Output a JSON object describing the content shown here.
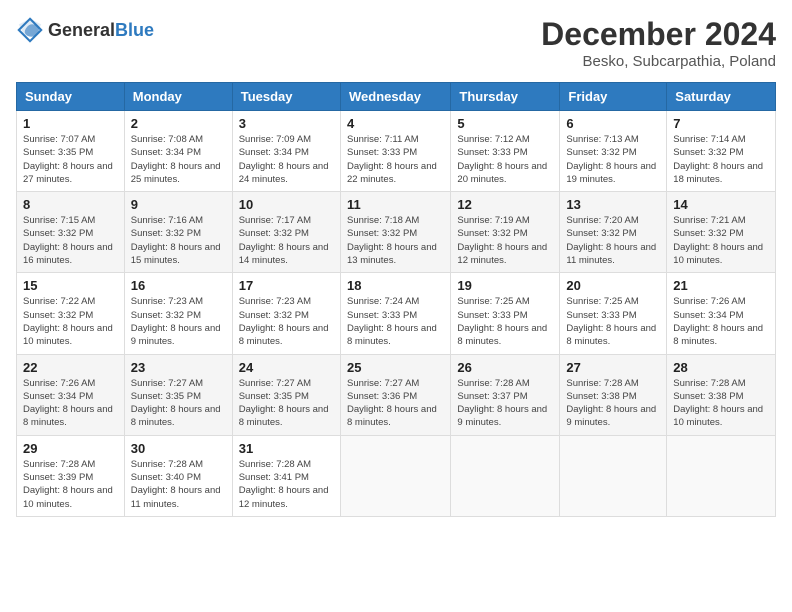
{
  "header": {
    "logo_general": "General",
    "logo_blue": "Blue",
    "month_year": "December 2024",
    "location": "Besko, Subcarpathia, Poland"
  },
  "weekdays": [
    "Sunday",
    "Monday",
    "Tuesday",
    "Wednesday",
    "Thursday",
    "Friday",
    "Saturday"
  ],
  "weeks": [
    [
      {
        "day": "1",
        "sunrise": "Sunrise: 7:07 AM",
        "sunset": "Sunset: 3:35 PM",
        "daylight": "Daylight: 8 hours and 27 minutes."
      },
      {
        "day": "2",
        "sunrise": "Sunrise: 7:08 AM",
        "sunset": "Sunset: 3:34 PM",
        "daylight": "Daylight: 8 hours and 25 minutes."
      },
      {
        "day": "3",
        "sunrise": "Sunrise: 7:09 AM",
        "sunset": "Sunset: 3:34 PM",
        "daylight": "Daylight: 8 hours and 24 minutes."
      },
      {
        "day": "4",
        "sunrise": "Sunrise: 7:11 AM",
        "sunset": "Sunset: 3:33 PM",
        "daylight": "Daylight: 8 hours and 22 minutes."
      },
      {
        "day": "5",
        "sunrise": "Sunrise: 7:12 AM",
        "sunset": "Sunset: 3:33 PM",
        "daylight": "Daylight: 8 hours and 20 minutes."
      },
      {
        "day": "6",
        "sunrise": "Sunrise: 7:13 AM",
        "sunset": "Sunset: 3:32 PM",
        "daylight": "Daylight: 8 hours and 19 minutes."
      },
      {
        "day": "7",
        "sunrise": "Sunrise: 7:14 AM",
        "sunset": "Sunset: 3:32 PM",
        "daylight": "Daylight: 8 hours and 18 minutes."
      }
    ],
    [
      {
        "day": "8",
        "sunrise": "Sunrise: 7:15 AM",
        "sunset": "Sunset: 3:32 PM",
        "daylight": "Daylight: 8 hours and 16 minutes."
      },
      {
        "day": "9",
        "sunrise": "Sunrise: 7:16 AM",
        "sunset": "Sunset: 3:32 PM",
        "daylight": "Daylight: 8 hours and 15 minutes."
      },
      {
        "day": "10",
        "sunrise": "Sunrise: 7:17 AM",
        "sunset": "Sunset: 3:32 PM",
        "daylight": "Daylight: 8 hours and 14 minutes."
      },
      {
        "day": "11",
        "sunrise": "Sunrise: 7:18 AM",
        "sunset": "Sunset: 3:32 PM",
        "daylight": "Daylight: 8 hours and 13 minutes."
      },
      {
        "day": "12",
        "sunrise": "Sunrise: 7:19 AM",
        "sunset": "Sunset: 3:32 PM",
        "daylight": "Daylight: 8 hours and 12 minutes."
      },
      {
        "day": "13",
        "sunrise": "Sunrise: 7:20 AM",
        "sunset": "Sunset: 3:32 PM",
        "daylight": "Daylight: 8 hours and 11 minutes."
      },
      {
        "day": "14",
        "sunrise": "Sunrise: 7:21 AM",
        "sunset": "Sunset: 3:32 PM",
        "daylight": "Daylight: 8 hours and 10 minutes."
      }
    ],
    [
      {
        "day": "15",
        "sunrise": "Sunrise: 7:22 AM",
        "sunset": "Sunset: 3:32 PM",
        "daylight": "Daylight: 8 hours and 10 minutes."
      },
      {
        "day": "16",
        "sunrise": "Sunrise: 7:23 AM",
        "sunset": "Sunset: 3:32 PM",
        "daylight": "Daylight: 8 hours and 9 minutes."
      },
      {
        "day": "17",
        "sunrise": "Sunrise: 7:23 AM",
        "sunset": "Sunset: 3:32 PM",
        "daylight": "Daylight: 8 hours and 8 minutes."
      },
      {
        "day": "18",
        "sunrise": "Sunrise: 7:24 AM",
        "sunset": "Sunset: 3:33 PM",
        "daylight": "Daylight: 8 hours and 8 minutes."
      },
      {
        "day": "19",
        "sunrise": "Sunrise: 7:25 AM",
        "sunset": "Sunset: 3:33 PM",
        "daylight": "Daylight: 8 hours and 8 minutes."
      },
      {
        "day": "20",
        "sunrise": "Sunrise: 7:25 AM",
        "sunset": "Sunset: 3:33 PM",
        "daylight": "Daylight: 8 hours and 8 minutes."
      },
      {
        "day": "21",
        "sunrise": "Sunrise: 7:26 AM",
        "sunset": "Sunset: 3:34 PM",
        "daylight": "Daylight: 8 hours and 8 minutes."
      }
    ],
    [
      {
        "day": "22",
        "sunrise": "Sunrise: 7:26 AM",
        "sunset": "Sunset: 3:34 PM",
        "daylight": "Daylight: 8 hours and 8 minutes."
      },
      {
        "day": "23",
        "sunrise": "Sunrise: 7:27 AM",
        "sunset": "Sunset: 3:35 PM",
        "daylight": "Daylight: 8 hours and 8 minutes."
      },
      {
        "day": "24",
        "sunrise": "Sunrise: 7:27 AM",
        "sunset": "Sunset: 3:35 PM",
        "daylight": "Daylight: 8 hours and 8 minutes."
      },
      {
        "day": "25",
        "sunrise": "Sunrise: 7:27 AM",
        "sunset": "Sunset: 3:36 PM",
        "daylight": "Daylight: 8 hours and 8 minutes."
      },
      {
        "day": "26",
        "sunrise": "Sunrise: 7:28 AM",
        "sunset": "Sunset: 3:37 PM",
        "daylight": "Daylight: 8 hours and 9 minutes."
      },
      {
        "day": "27",
        "sunrise": "Sunrise: 7:28 AM",
        "sunset": "Sunset: 3:38 PM",
        "daylight": "Daylight: 8 hours and 9 minutes."
      },
      {
        "day": "28",
        "sunrise": "Sunrise: 7:28 AM",
        "sunset": "Sunset: 3:38 PM",
        "daylight": "Daylight: 8 hours and 10 minutes."
      }
    ],
    [
      {
        "day": "29",
        "sunrise": "Sunrise: 7:28 AM",
        "sunset": "Sunset: 3:39 PM",
        "daylight": "Daylight: 8 hours and 10 minutes."
      },
      {
        "day": "30",
        "sunrise": "Sunrise: 7:28 AM",
        "sunset": "Sunset: 3:40 PM",
        "daylight": "Daylight: 8 hours and 11 minutes."
      },
      {
        "day": "31",
        "sunrise": "Sunrise: 7:28 AM",
        "sunset": "Sunset: 3:41 PM",
        "daylight": "Daylight: 8 hours and 12 minutes."
      },
      null,
      null,
      null,
      null
    ]
  ]
}
